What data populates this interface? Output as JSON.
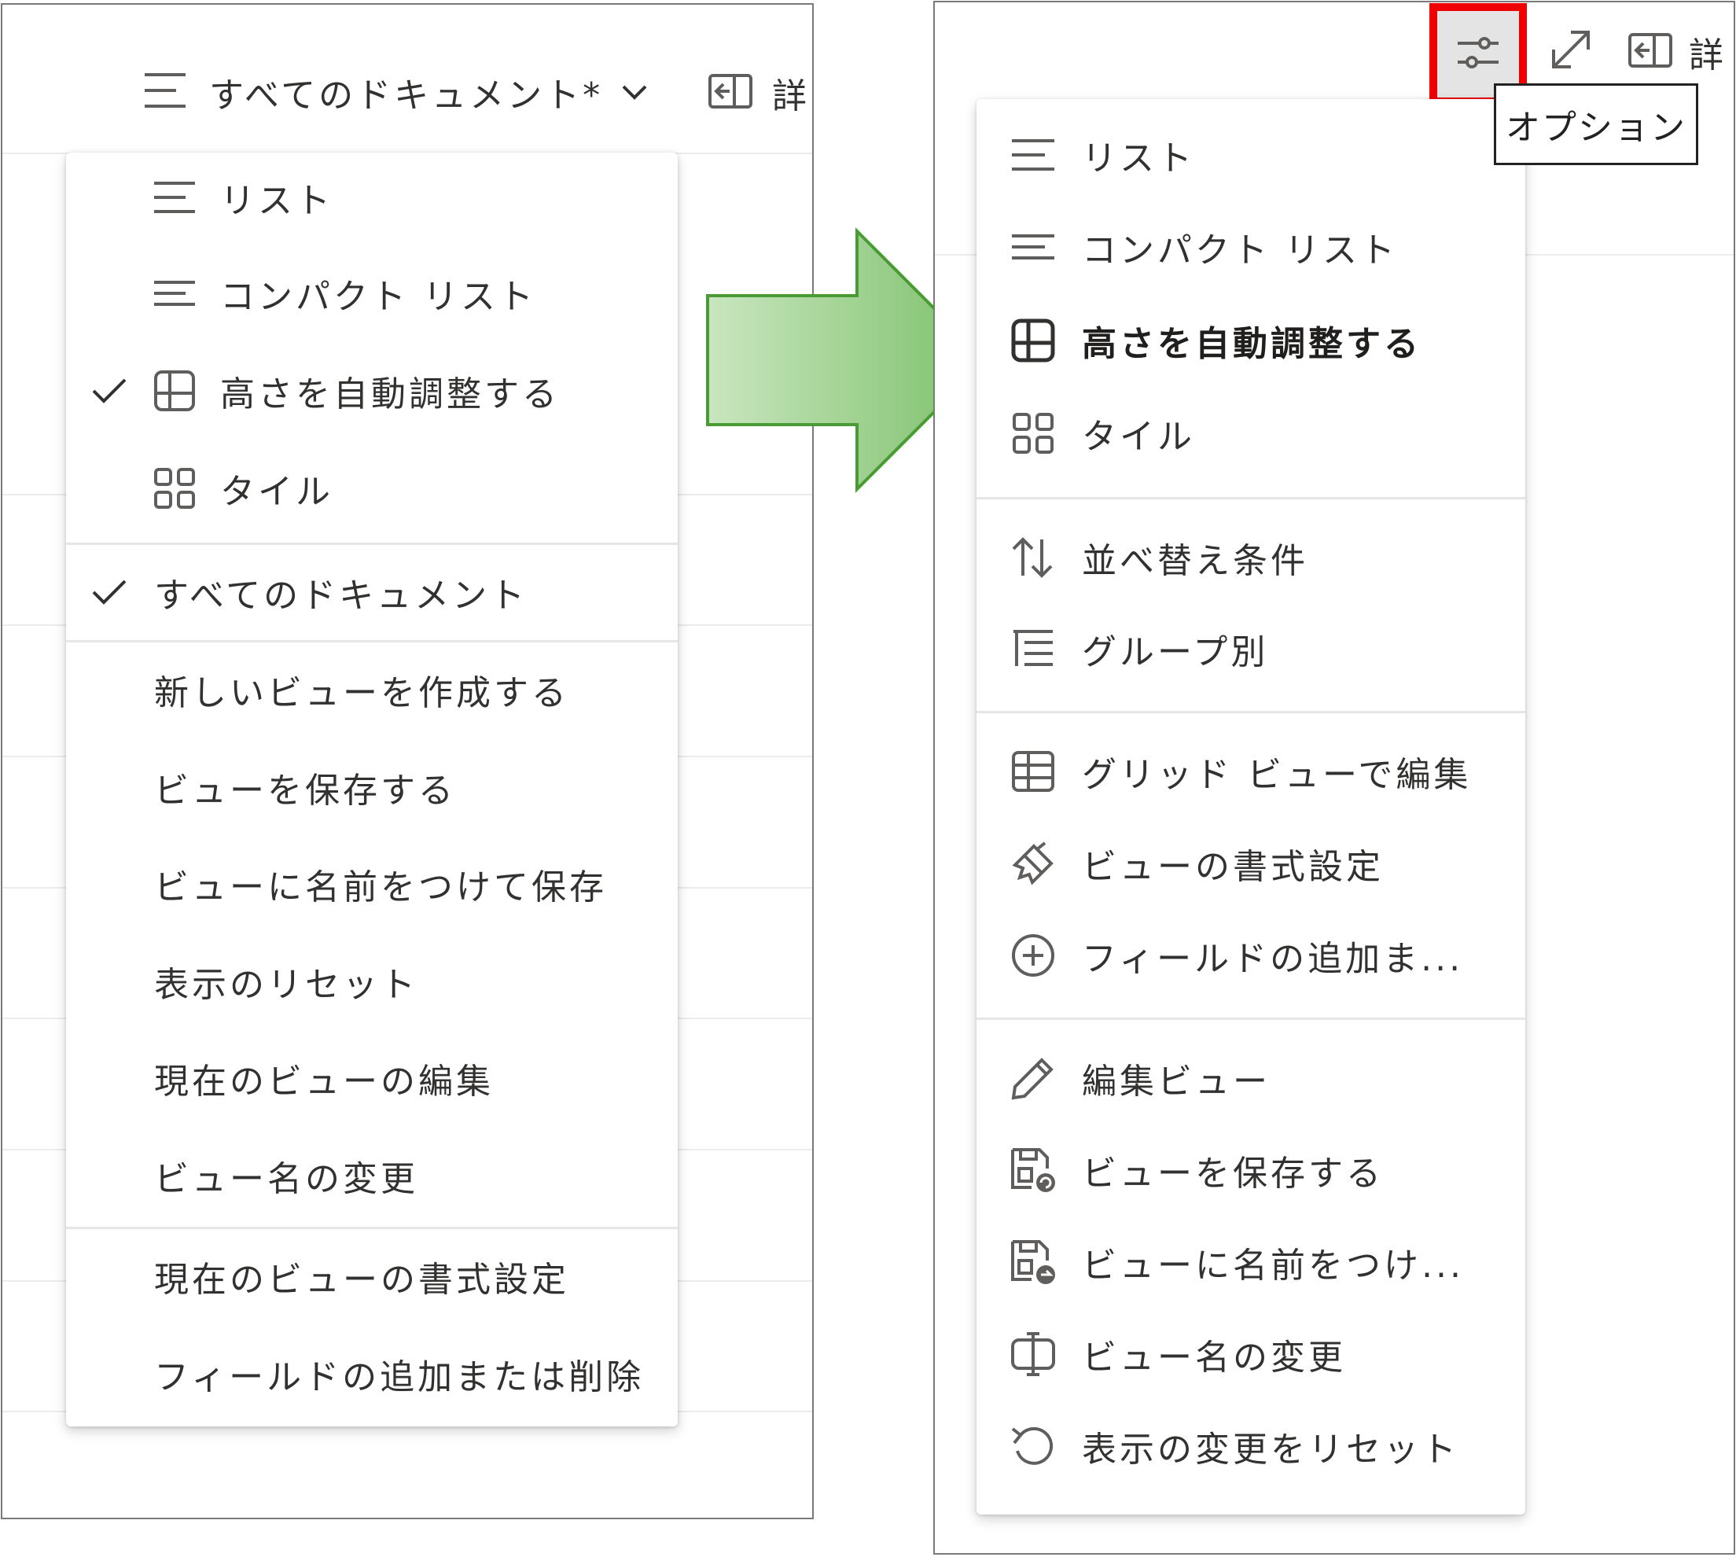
{
  "left": {
    "header": {
      "view_title": "すべてのドキュメント*",
      "details_label": "詳"
    },
    "menu": {
      "layouts": [
        {
          "label": "リスト",
          "icon": "list-icon",
          "checked": false
        },
        {
          "label": "コンパクト リスト",
          "icon": "compact-list-icon",
          "checked": false
        },
        {
          "label": "高さを自動調整する",
          "icon": "autofit-height-icon",
          "checked": true
        },
        {
          "label": "タイル",
          "icon": "tiles-icon",
          "checked": false
        }
      ],
      "current_view": {
        "label": "すべてのドキュメント",
        "checked": true
      },
      "view_actions": [
        "新しいビューを作成する",
        "ビューを保存する",
        "ビューに名前をつけて保存",
        "表示のリセット",
        "現在のビューの編集",
        "ビュー名の変更"
      ],
      "format_actions": [
        "現在のビューの書式設定",
        "フィールドの追加または削除"
      ]
    }
  },
  "right": {
    "header": {
      "options_icon": "options-sliders-icon",
      "expand_icon": "expand-icon",
      "details_label": "詳",
      "tooltip": "オプション",
      "highlight_color": "#f00000"
    },
    "menu": {
      "layouts": [
        {
          "label": "リスト",
          "icon": "list-icon",
          "selected": false
        },
        {
          "label": "コンパクト リスト",
          "icon": "compact-list-icon",
          "selected": false
        },
        {
          "label": "高さを自動調整する",
          "icon": "autofit-height-icon",
          "selected": true
        },
        {
          "label": "タイル",
          "icon": "tiles-icon",
          "selected": false
        }
      ],
      "arrange": [
        {
          "label": "並べ替え条件",
          "icon": "sort-icon"
        },
        {
          "label": "グループ別",
          "icon": "group-by-icon"
        }
      ],
      "edit": [
        {
          "label": "グリッド ビューで編集",
          "icon": "grid-view-icon"
        },
        {
          "label": "ビューの書式設定",
          "icon": "format-brush-icon"
        },
        {
          "label": "フィールドの追加ま...",
          "icon": "add-circle-icon"
        }
      ],
      "view": [
        {
          "label": "編集ビュー",
          "icon": "pencil-icon"
        },
        {
          "label": "ビューを保存する",
          "icon": "save-view-icon"
        },
        {
          "label": "ビューに名前をつけ...",
          "icon": "save-as-icon"
        },
        {
          "label": "ビュー名の変更",
          "icon": "rename-icon"
        },
        {
          "label": "表示の変更をリセット",
          "icon": "reset-icon"
        }
      ]
    }
  },
  "arrow": {
    "fill_from": "#c9e6bf",
    "fill_to": "#7cc06a",
    "stroke": "#4a9a35"
  }
}
